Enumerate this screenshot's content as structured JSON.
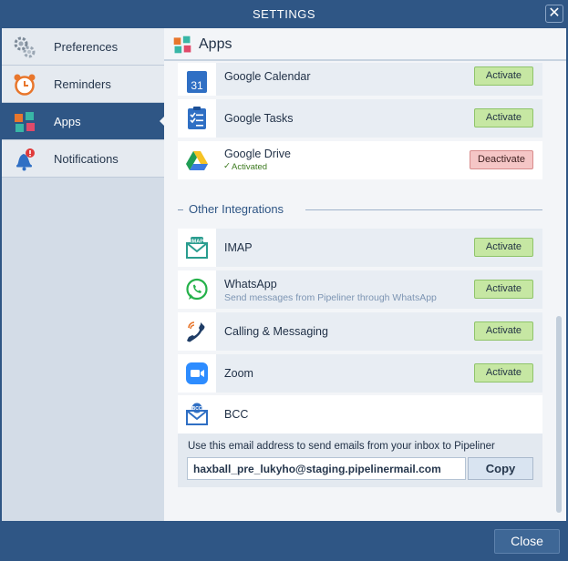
{
  "window": {
    "title": "SETTINGS",
    "close_glyph": "✕"
  },
  "sidebar": {
    "items": [
      {
        "label": "Preferences",
        "icon": "gears-icon",
        "active": false
      },
      {
        "label": "Reminders",
        "icon": "alarm-clock-icon",
        "active": false
      },
      {
        "label": "Apps",
        "icon": "apps-puzzle-icon",
        "active": true
      },
      {
        "label": "Notifications",
        "icon": "bell-alert-icon",
        "active": false
      }
    ]
  },
  "main": {
    "title": "Apps",
    "apps": [
      {
        "name": "Google Calendar",
        "icon": "google-calendar-icon",
        "icon_text": "31",
        "action": "Activate"
      },
      {
        "name": "Google Tasks",
        "icon": "google-tasks-icon",
        "action": "Activate"
      },
      {
        "name": "Google Drive",
        "icon": "google-drive-icon",
        "status": "Activated",
        "status_glyph": "✓",
        "action": "Deactivate"
      }
    ],
    "other_section_title": "Other Integrations",
    "integrations": [
      {
        "name": "IMAP",
        "icon": "imap-mail-icon",
        "icon_text": "IMAP",
        "action": "Activate"
      },
      {
        "name": "WhatsApp",
        "icon": "whatsapp-icon",
        "subtitle": "Send messages from Pipeliner through WhatsApp",
        "action": "Activate"
      },
      {
        "name": "Calling & Messaging",
        "icon": "phone-call-icon",
        "action": "Activate"
      },
      {
        "name": "Zoom",
        "icon": "zoom-camera-icon",
        "action": "Activate"
      },
      {
        "name": "BCC",
        "icon": "bcc-mail-icon",
        "icon_text": "BCC"
      }
    ],
    "bcc": {
      "description": "Use this email address to send emails from your inbox to Pipeliner",
      "email": "haxball_pre_lukyho@staging.pipelinermail.com",
      "copy_label": "Copy"
    }
  },
  "footer": {
    "close_label": "Close"
  },
  "colors": {
    "header": "#2f5685",
    "activate": "#c6e7a3",
    "deactivate": "#f5c6c6",
    "sidebar_active": "#2f5685"
  }
}
